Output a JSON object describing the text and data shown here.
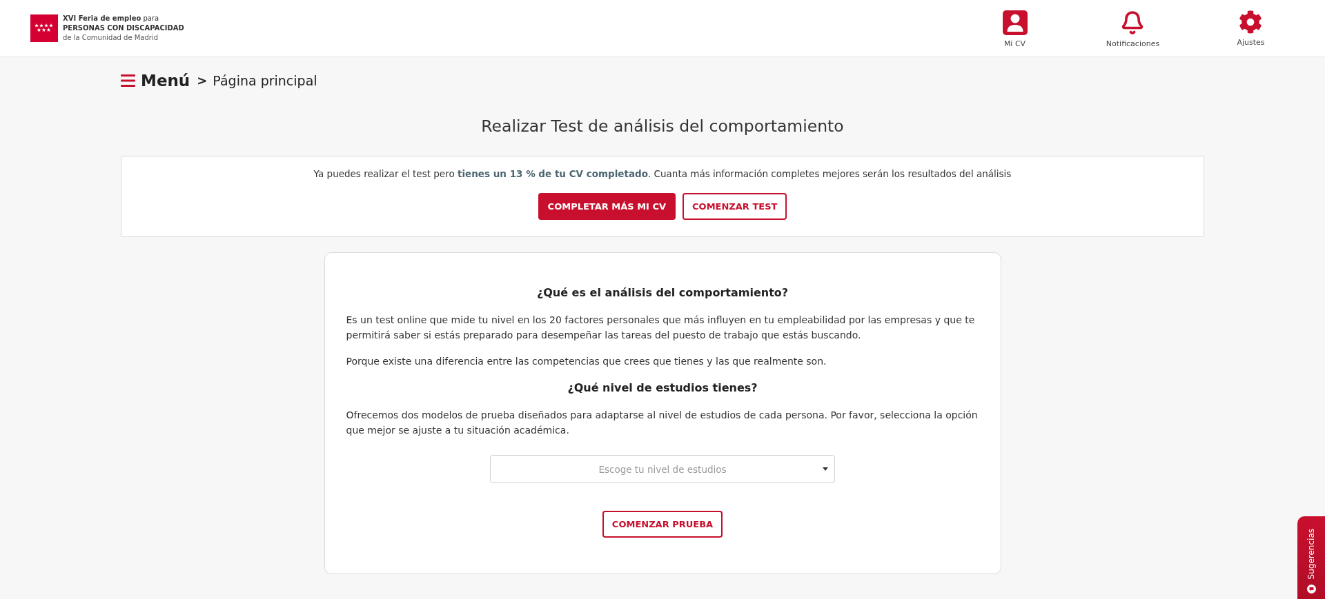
{
  "header": {
    "logo": {
      "title": "**XVI Feria de empleo** para",
      "subtitle": "PERSONAS CON DISCAPACIDAD",
      "caption": "de la Comunidad de Madrid"
    },
    "nav": [
      {
        "kind": "profile",
        "label": "Mi CV"
      },
      {
        "kind": "notifications",
        "label": "Notificaciones"
      },
      {
        "kind": "settings",
        "label": "Ajustes"
      }
    ]
  },
  "breadcrumb": {
    "menu": "Menú",
    "separator": ">",
    "current": "Página principal"
  },
  "page_title": "Realizar Test de análisis del comportamiento",
  "notice": {
    "text": "Ya puedes realizar el test pero **tienes un 13 % de tu CV completado**. Cuanta más información completes mejores serán los resultados del análisis",
    "buttons": [
      {
        "kind": "filled",
        "label": "COMPLETAR MÁS MI CV"
      },
      {
        "kind": "outline",
        "label": "COMENZAR TEST"
      }
    ]
  },
  "card": {
    "blocks": [
      {
        "kind": "heading",
        "text": "¿Qué es el análisis del comportamiento?"
      },
      {
        "kind": "paragraph",
        "text": "Es un test online que mide tu nivel en los 20 factores personales que más influyen en tu empleabilidad por las empresas y que te permitirá saber si estás preparado para desempeñar las tareas del puesto de trabajo que estás buscando."
      },
      {
        "kind": "paragraph",
        "text": "Porque existe una diferencia entre las competencias que crees que tienes y las que realmente son."
      },
      {
        "kind": "heading",
        "text": "¿Qué nivel de estudios tienes?"
      },
      {
        "kind": "paragraph",
        "text": "Ofrecemos dos modelos de prueba diseñados para adaptarse al nivel de estudios de cada persona. Por favor, selecciona la opción que mejor se ajuste a tu situación académica."
      }
    ],
    "select": {
      "placeholder": "Escoge tu nivel de estudios"
    },
    "button": {
      "label": "COMENZAR PRUEBA"
    }
  },
  "feedback_tab": {
    "label": "Sugerencias"
  }
}
